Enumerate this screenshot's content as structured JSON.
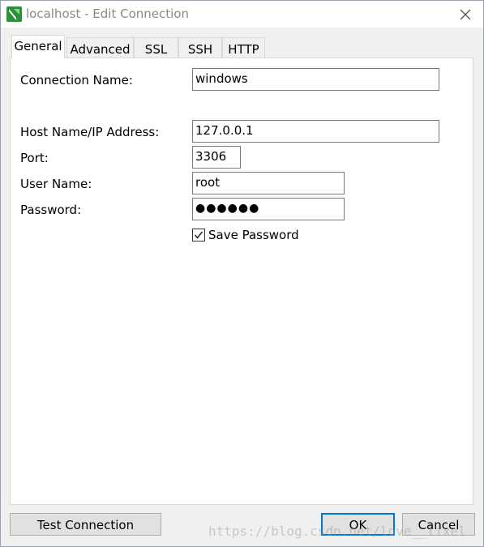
{
  "window": {
    "title": "localhost - Edit Connection"
  },
  "tabs": [
    {
      "label": "General"
    },
    {
      "label": "Advanced"
    },
    {
      "label": "SSL"
    },
    {
      "label": "SSH"
    },
    {
      "label": "HTTP"
    }
  ],
  "form": {
    "connection_name_label": "Connection Name:",
    "connection_name_value": "windows",
    "host_label": "Host Name/IP Address:",
    "host_value": "127.0.0.1",
    "port_label": "Port:",
    "port_value": "3306",
    "user_label": "User Name:",
    "user_value": "root",
    "password_label": "Password:",
    "password_value": "●●●●●●",
    "save_password_label": "Save Password"
  },
  "buttons": {
    "test_connection": "Test Connection",
    "ok": "OK",
    "cancel": "Cancel"
  },
  "watermark": "https://blog.csdn.net/love__lixel",
  "colors": {
    "accent": "#0078d7",
    "app_icon": "#2f8f3a"
  }
}
